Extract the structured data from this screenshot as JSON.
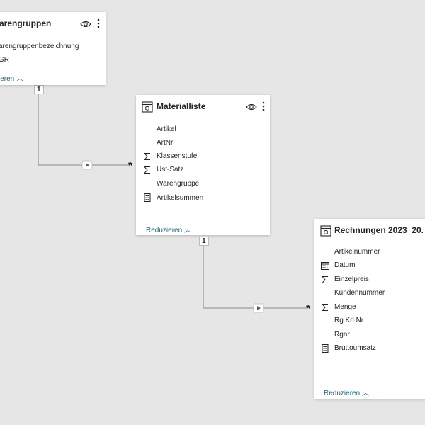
{
  "tables": {
    "warengruppen": {
      "title": "arengruppen",
      "fields": [
        "arengruppenbezeichnung",
        "GR"
      ],
      "collapse_label": "ieren"
    },
    "materialliste": {
      "title": "Materialliste",
      "fields": [
        "Artikel",
        "ArtNr",
        "Klassenstufe",
        "Ust-Satz",
        "Warengruppe",
        "Artikelsummen"
      ],
      "field_icons": [
        "",
        "",
        "sigma-icon",
        "sigma-icon",
        "",
        "calculator-icon"
      ],
      "collapse_label": "Reduzieren"
    },
    "rechnungen": {
      "title": "Rechnungen 2023_20...",
      "fields": [
        "Artikelnummer",
        "Datum",
        "Einzelpreis",
        "Kundennummer",
        "Menge",
        "Rg Kd Nr",
        "Rgnr",
        "Bruttoumsatz"
      ],
      "field_icons": [
        "",
        "calendar-icon",
        "sigma-icon",
        "",
        "sigma-icon",
        "",
        "",
        "calculator-icon"
      ],
      "collapse_label": "Reduzieren"
    }
  },
  "relationships": [
    {
      "from": "warengruppen",
      "to": "materialliste",
      "one_label": "1",
      "many_label": "*"
    },
    {
      "from": "materialliste",
      "to": "rechnungen",
      "one_label": "1",
      "many_label": "*"
    }
  ],
  "colors": {
    "canvas": "#e6e6e6",
    "card": "#ffffff",
    "link": "#1b6680",
    "line": "#8a8886"
  }
}
